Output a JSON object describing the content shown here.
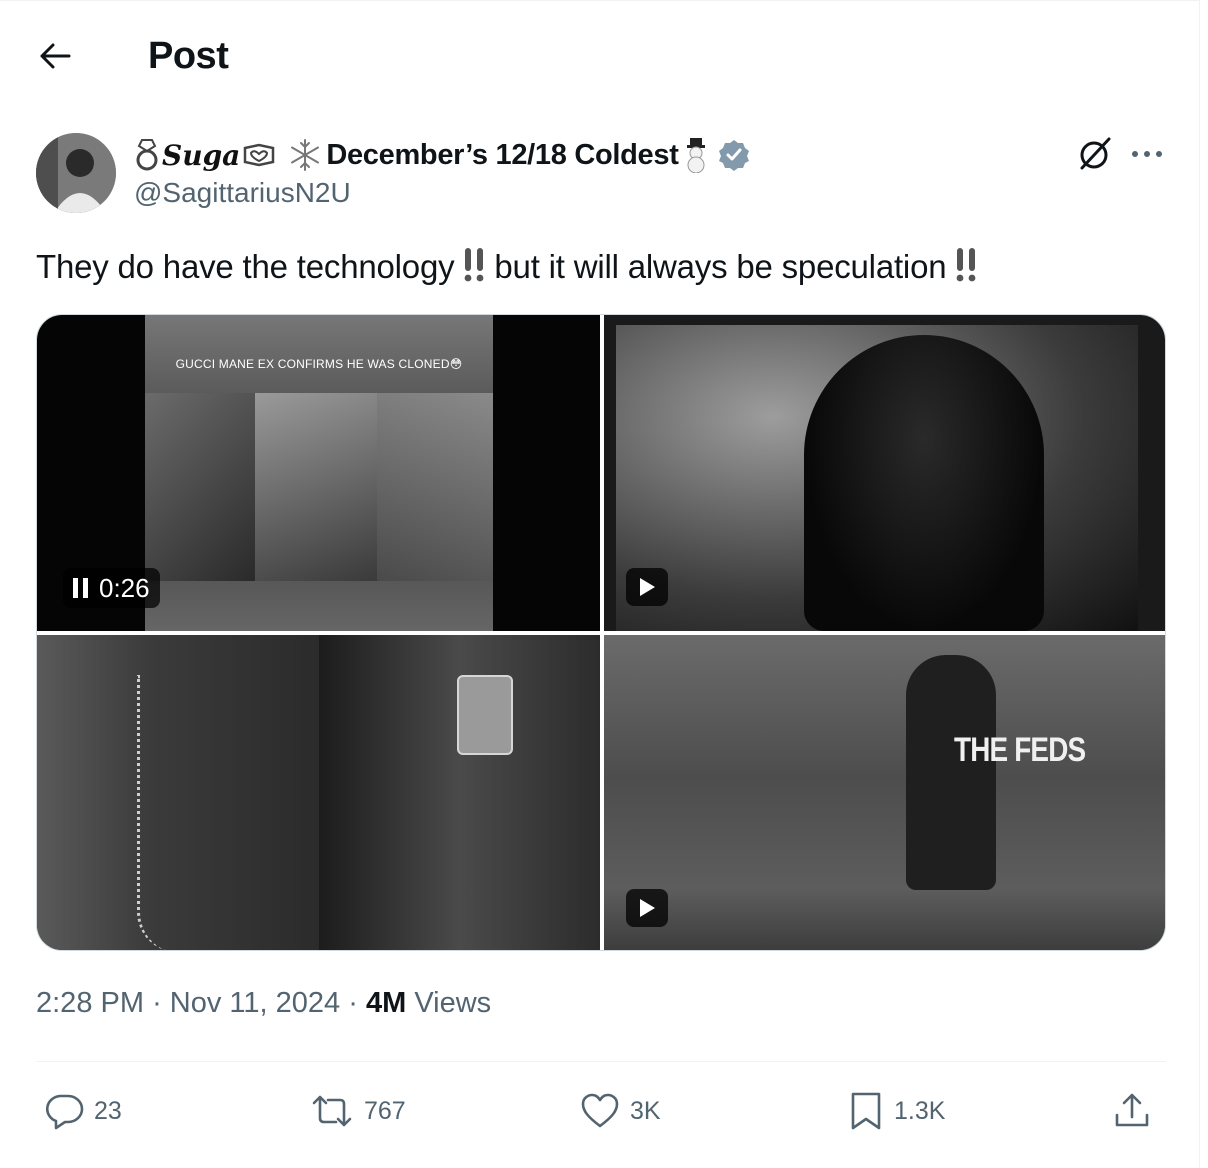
{
  "header": {
    "title": "Post",
    "back_icon": "arrow-left-icon"
  },
  "author": {
    "display_name_prefix_icon": "ring-icon",
    "display_name_script": "Suga",
    "display_name_heart_icon": "heart-outline-icon",
    "display_name_snow_icon": "snowflake-icon",
    "display_name_main": "December’s 12/18 Coldest",
    "display_name_suffix_icon": "snowman-icon",
    "verified_icon": "verified-badge-icon",
    "handle": "@SagittariusN2U"
  },
  "post": {
    "text_part1": "They do have the technology",
    "text_part2": "but it will always be speculation",
    "emphasis_icon": "double-exclamation-icon"
  },
  "media": {
    "video1": {
      "caption": "GUCCI MANE EX CONFIRMS HE WAS CLONED😳",
      "timestamp": "0:26",
      "state_icon": "pause-icon"
    },
    "video2": {
      "play_icon": "play-icon"
    },
    "image3": {},
    "video4": {
      "overlay_text": "THE FEDS",
      "play_icon": "play-icon"
    }
  },
  "meta": {
    "time": "2:28 PM",
    "separator": "·",
    "date": "Nov 11, 2024",
    "views_count": "4M",
    "views_label": "Views"
  },
  "actions": {
    "reply": {
      "count": "23",
      "icon": "reply-icon"
    },
    "repost": {
      "count": "767",
      "icon": "repost-icon"
    },
    "like": {
      "count": "3K",
      "icon": "heart-icon"
    },
    "bookmark": {
      "count": "1.3K",
      "icon": "bookmark-icon"
    },
    "share": {
      "icon": "share-icon"
    }
  },
  "colors": {
    "text_primary": "#0f1419",
    "text_secondary": "#536471",
    "divider": "#eff3f4",
    "media_border": "#cfd9de"
  }
}
